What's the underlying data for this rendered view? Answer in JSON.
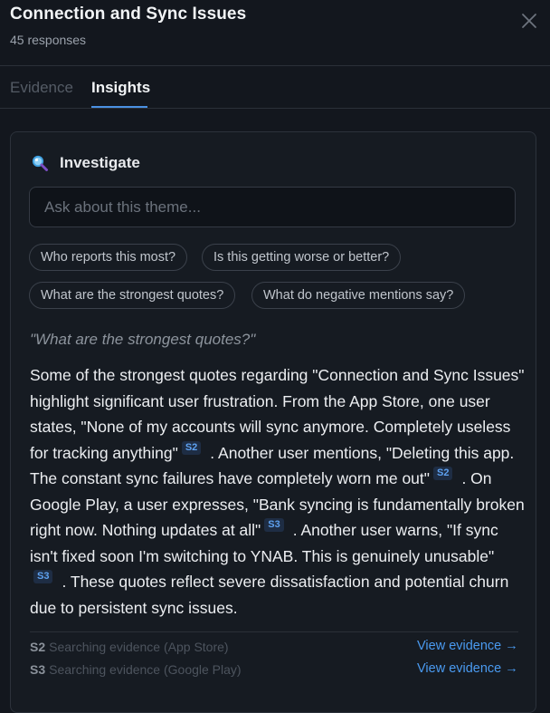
{
  "header": {
    "title": "Connection and Sync Issues",
    "subtitle": "45 responses",
    "close_icon": "close-icon"
  },
  "tabs": [
    {
      "label": "Evidence",
      "active": false
    },
    {
      "label": "Insights",
      "active": true
    }
  ],
  "investigate": {
    "icon": "magnifier-icon",
    "label": "Investigate",
    "placeholder": "Ask about this theme...",
    "value": "",
    "suggestions": [
      "Who reports this most?",
      "Is this getting worse or better?",
      "What are the strongest quotes?",
      "What do negative mentions say?"
    ]
  },
  "conversation": {
    "question": "\"What are the strongest quotes?\"",
    "answer": [
      {
        "text": "Some of the strongest quotes regarding \"Connection and Sync Issues\" highlight significant user frustration. From the App Store, one user states, \"None of my accounts will sync anymore. Completely useless for tracking anything\""
      },
      {
        "cite": "S2"
      },
      {
        "text": ". Another user mentions, \"Deleting this app. The constant sync failures have completely worn me out\""
      },
      {
        "cite": "S2"
      },
      {
        "text": ". On Google Play, a user expresses, \"Bank syncing is fundamentally broken right now. Nothing updates at all\""
      },
      {
        "cite": "S3"
      },
      {
        "text": ". Another user warns, \"If sync isn't fixed soon I'm switching to YNAB. This is genuinely unusable\""
      },
      {
        "cite": "S3"
      },
      {
        "text": ". These quotes reflect severe dissatisfaction and potential churn due to persistent sync issues."
      }
    ]
  },
  "sources": [
    {
      "id": "S2",
      "status": "Searching evidence (App Store)",
      "link": "View evidence →"
    },
    {
      "id": "S3",
      "status": "Searching evidence (Google Play)",
      "link": "View evidence →"
    }
  ],
  "colors": {
    "background": "#13171e",
    "accent": "#4a90e2",
    "citation_bg": "#1e2d44"
  }
}
